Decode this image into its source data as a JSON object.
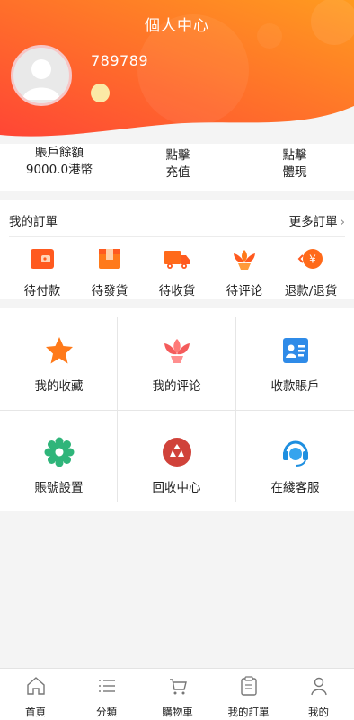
{
  "header": {
    "title": "個人中心",
    "username": "789789",
    "gradient_start": "#ff4a3a",
    "gradient_end": "#ff9a1e"
  },
  "balance": {
    "account": {
      "label": "賬戶餘額",
      "value": "9000.0港幣"
    },
    "recharge": {
      "line1": "點擊",
      "line2": "充值"
    },
    "withdraw": {
      "line1": "點擊",
      "line2": "體現"
    }
  },
  "orders": {
    "title": "我的訂單",
    "more": "更多訂單",
    "items": [
      {
        "label": "待付款",
        "icon": "wallet-icon"
      },
      {
        "label": "待發貨",
        "icon": "package-icon"
      },
      {
        "label": "待收貨",
        "icon": "truck-icon"
      },
      {
        "label": "待评论",
        "icon": "flower-icon"
      },
      {
        "label": "退款/退貨",
        "icon": "refund-icon"
      }
    ]
  },
  "services": [
    {
      "label": "我的收藏",
      "icon": "star-icon"
    },
    {
      "label": "我的评论",
      "icon": "flower-icon"
    },
    {
      "label": "收款賬戶",
      "icon": "contact-card-icon"
    },
    {
      "label": "賬號設置",
      "icon": "gear-icon"
    },
    {
      "label": "回收中心",
      "icon": "recycle-icon"
    },
    {
      "label": "在綫客服",
      "icon": "headset-icon"
    }
  ],
  "tabbar": [
    {
      "label": "首頁",
      "icon": "home-icon"
    },
    {
      "label": "分類",
      "icon": "list-icon"
    },
    {
      "label": "購物車",
      "icon": "cart-icon"
    },
    {
      "label": "我的訂單",
      "icon": "clipboard-icon"
    },
    {
      "label": "我的",
      "icon": "person-icon"
    }
  ]
}
